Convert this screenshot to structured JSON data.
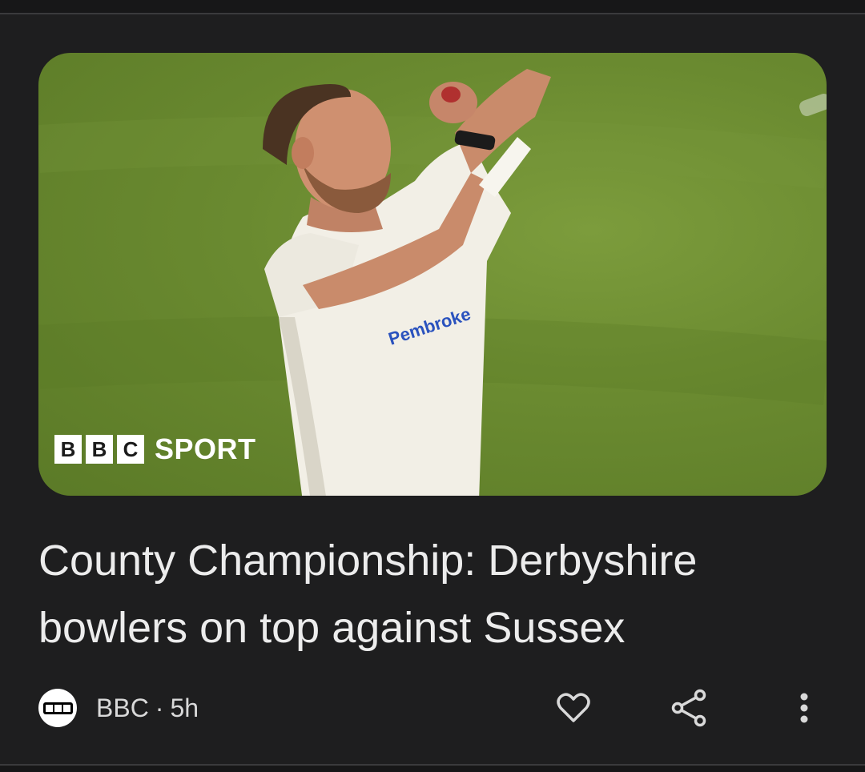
{
  "article": {
    "image_alt": "Cricket bowler in white kit",
    "shirt_sponsor": "Pembroke",
    "watermark": {
      "letters": [
        "B",
        "B",
        "C"
      ],
      "word": "SPORT"
    },
    "headline": "County Championship: Derbyshire bowlers on top against Sussex",
    "source": "BBC",
    "separator": "·",
    "time_ago": "5h"
  },
  "icons": {
    "source": "bbc-source-icon",
    "like": "heart-icon",
    "share": "share-icon",
    "more": "more-vert-icon"
  },
  "colors": {
    "background": "#1e1e1f",
    "headline": "#ececec",
    "meta_text": "#d9d9d9",
    "pitch": "#6a8a30"
  }
}
